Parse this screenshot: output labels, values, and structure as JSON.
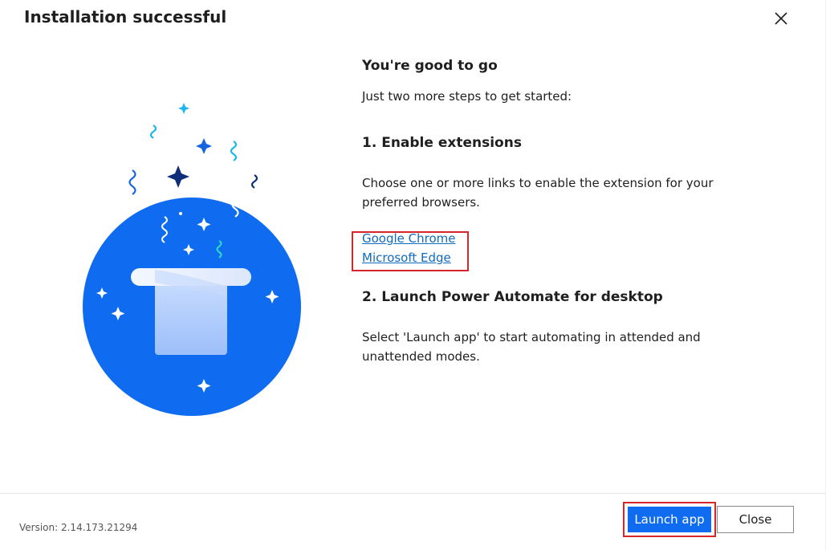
{
  "dialog": {
    "title": "Installation successful"
  },
  "content": {
    "heading": "You're good to go",
    "intro": "Just two more steps to get started:",
    "step1_heading": "1. Enable extensions",
    "step1_text": "Choose one or more links to enable the extension for your preferred browsers.",
    "links": [
      {
        "label": "Google Chrome"
      },
      {
        "label": "Microsoft Edge"
      }
    ],
    "step2_heading": "2. Launch Power Automate for desktop",
    "step2_text": "Select 'Launch app' to start automating in attended and unattended modes."
  },
  "footer": {
    "version": "Version: 2.14.173.21294",
    "launch_label": "Launch app",
    "close_label": "Close"
  },
  "icons": {
    "close": "close-icon",
    "illustration": "magic-hat-illustration"
  },
  "colors": {
    "accent": "#0f6cf0",
    "link": "#0f6cbd",
    "highlight_border": "#d4262b",
    "circle": "#0f6cf0"
  }
}
